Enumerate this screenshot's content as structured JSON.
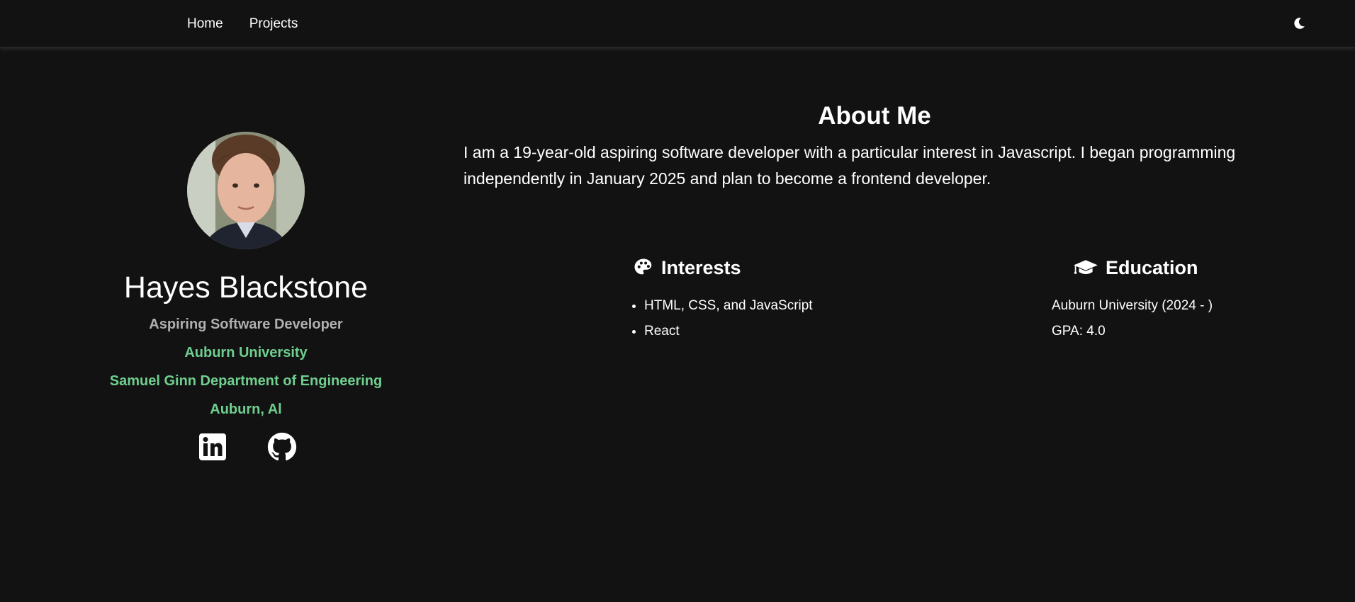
{
  "nav": {
    "links": [
      "Home",
      "Projects"
    ],
    "theme_toggle_icon": "moon-icon"
  },
  "profile": {
    "name": "Hayes Blackstone",
    "title": "Aspiring Software Developer",
    "university": "Auburn University",
    "department": "Samuel Ginn Department of Engineering",
    "location": "Auburn, Al",
    "socials": [
      "linkedin-icon",
      "github-icon"
    ],
    "accent_color": "#6fcf8f"
  },
  "about": {
    "heading": "About Me",
    "text": "I am a 19-year-old aspiring software developer with a particular interest in Javascript. I began programming independently in January 2025 and plan to become a frontend developer."
  },
  "interests": {
    "heading": "Interests",
    "icon": "palette-icon",
    "items": [
      "HTML, CSS, and JavaScript",
      "React"
    ]
  },
  "education": {
    "heading": "Education",
    "icon": "graduation-cap-icon",
    "items": [
      "Auburn University (2024 - )",
      "GPA: 4.0"
    ]
  }
}
